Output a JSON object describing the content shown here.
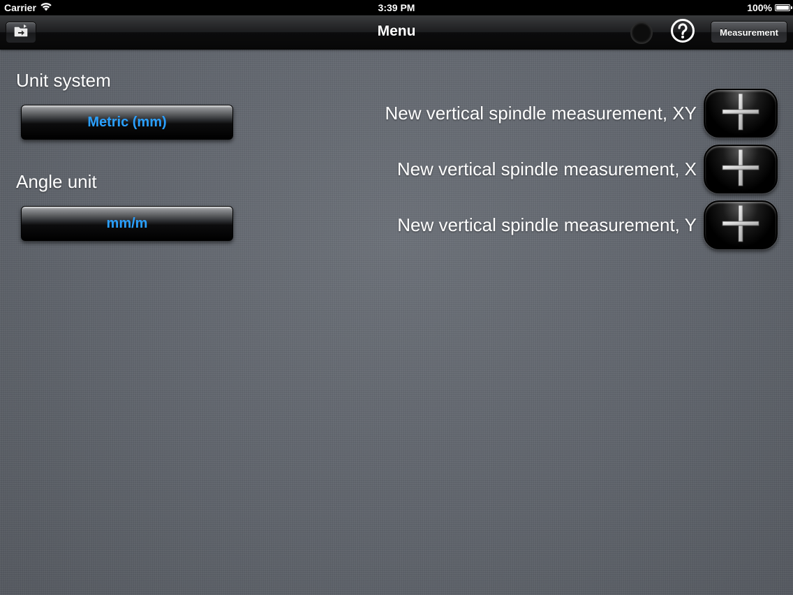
{
  "status_bar": {
    "carrier": "Carrier",
    "time": "3:39 PM",
    "battery": "100%",
    "battery_level": 1.0
  },
  "nav": {
    "title": "Menu",
    "left_icon": "folder-arrow-icon",
    "help_icon": "question-circle-icon",
    "measurement_label": "Measurement"
  },
  "settings": {
    "unit_system_label": "Unit system",
    "unit_system_value": "Metric (mm)",
    "angle_unit_label": "Angle unit",
    "angle_unit_value": "mm/m",
    "value_color": "#2aa0ff"
  },
  "actions": [
    {
      "label": "New vertical spindle measurement, XY",
      "icon": "plus-icon"
    },
    {
      "label": "New vertical spindle measurement, X",
      "icon": "plus-icon"
    },
    {
      "label": "New vertical spindle measurement, Y",
      "icon": "plus-icon"
    }
  ]
}
